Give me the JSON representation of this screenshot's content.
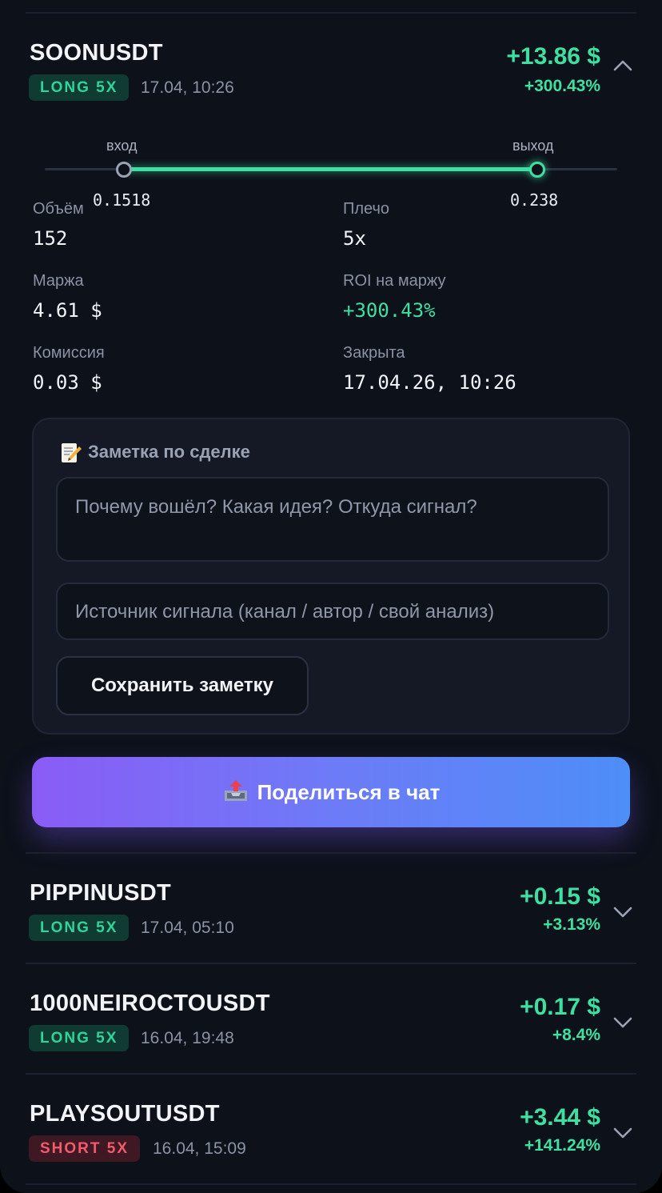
{
  "expanded_trade": {
    "symbol": "SOONUSDT",
    "side_label": "LONG 5X",
    "opened": "17.04, 10:26",
    "pnl_usd": "+13.86 $",
    "pnl_pct": "+300.43%",
    "entry_label": "вход",
    "exit_label": "выход",
    "entry_price": "0.1518",
    "exit_price": "0.238",
    "stats": {
      "volume_label": "Объём",
      "volume_value": "152",
      "leverage_label": "Плечо",
      "leverage_value": "5x",
      "margin_label": "Маржа",
      "margin_value": "4.61 $",
      "roi_label": "ROI на маржу",
      "roi_value": "+300.43%",
      "fee_label": "Комиссия",
      "fee_value": "0.03 $",
      "closed_label": "Закрыта",
      "closed_value": "17.04.26, 10:26"
    },
    "note": {
      "title": "Заметка по сделке",
      "idea_placeholder": "Почему вошёл? Какая идея? Откуда сигнал?",
      "source_placeholder": "Источник сигнала (канал / автор / свой анализ)",
      "save_label": "Сохранить заметку"
    },
    "share_label": "Поделиться в чат"
  },
  "trades": [
    {
      "symbol": "PIPPINUSDT",
      "side_label": "LONG 5X",
      "side": "long",
      "opened": "17.04, 05:10",
      "pnl_usd": "+0.15 $",
      "pnl_pct": "+3.13%"
    },
    {
      "symbol": "1000NEIROCTOUSDT",
      "side_label": "LONG 5X",
      "side": "long",
      "opened": "16.04, 19:48",
      "pnl_usd": "+0.17 $",
      "pnl_pct": "+8.4%"
    },
    {
      "symbol": "PLAYSOUTUSDT",
      "side_label": "SHORT 5X",
      "side": "short",
      "opened": "16.04, 15:09",
      "pnl_usd": "+3.44 $",
      "pnl_pct": "+141.24%"
    }
  ],
  "colors": {
    "profit": "#3ee0a2",
    "long_badge": "#2fd49b",
    "short_badge": "#f35a6e",
    "share_gradient_start": "#8a5cf6",
    "share_gradient_end": "#4d8ef8"
  },
  "icons": {
    "collapse": "chevron-up-icon",
    "expand": "chevron-down-icon",
    "note": "memo-icon",
    "share": "outbox-tray-icon"
  }
}
